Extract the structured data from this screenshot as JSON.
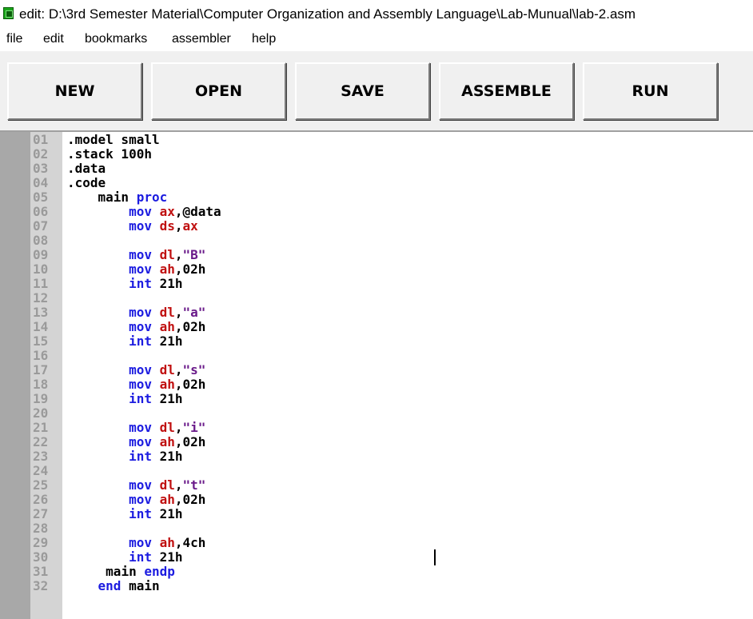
{
  "window": {
    "title": "edit: D:\\3rd Semester  Material\\Computer Organization and Assembly Language\\Lab-Munual\\lab-2.asm"
  },
  "menu": [
    "file",
    "edit",
    "bookmarks",
    "assembler",
    "help"
  ],
  "toolbar": {
    "new": "NEW",
    "open": "OPEN",
    "save": "SAVE",
    "assemble": "ASSEMBLE",
    "run": "RUN"
  },
  "editor": {
    "line_numbers": [
      "01",
      "02",
      "03",
      "04",
      "05",
      "06",
      "07",
      "08",
      "09",
      "10",
      "11",
      "12",
      "13",
      "14",
      "15",
      "16",
      "17",
      "18",
      "19",
      "20",
      "21",
      "22",
      "23",
      "24",
      "25",
      "26",
      "27",
      "28",
      "29",
      "30",
      "31",
      "32"
    ],
    "lines": [
      {
        "indent": "",
        "tokens": [
          {
            "t": ".model small",
            "c": "p"
          }
        ]
      },
      {
        "indent": "",
        "tokens": [
          {
            "t": ".stack 100h",
            "c": "p"
          }
        ]
      },
      {
        "indent": "",
        "tokens": [
          {
            "t": ".data",
            "c": "p"
          }
        ]
      },
      {
        "indent": "",
        "tokens": [
          {
            "t": ".code",
            "c": "p"
          }
        ]
      },
      {
        "indent": "    ",
        "tokens": [
          {
            "t": "main ",
            "c": "p"
          },
          {
            "t": "proc",
            "c": "k"
          }
        ]
      },
      {
        "indent": "        ",
        "tokens": [
          {
            "t": "mov ",
            "c": "k"
          },
          {
            "t": "ax",
            "c": "r"
          },
          {
            "t": ",@data",
            "c": "p"
          }
        ]
      },
      {
        "indent": "        ",
        "tokens": [
          {
            "t": "mov ",
            "c": "k"
          },
          {
            "t": "ds",
            "c": "r"
          },
          {
            "t": ",",
            "c": "p"
          },
          {
            "t": "ax",
            "c": "r"
          }
        ]
      },
      {
        "indent": "",
        "tokens": []
      },
      {
        "indent": "        ",
        "tokens": [
          {
            "t": "mov ",
            "c": "k"
          },
          {
            "t": "dl",
            "c": "r"
          },
          {
            "t": ",",
            "c": "p"
          },
          {
            "t": "\"B\"",
            "c": "s"
          }
        ]
      },
      {
        "indent": "        ",
        "tokens": [
          {
            "t": "mov ",
            "c": "k"
          },
          {
            "t": "ah",
            "c": "r"
          },
          {
            "t": ",02h",
            "c": "p"
          }
        ]
      },
      {
        "indent": "        ",
        "tokens": [
          {
            "t": "int ",
            "c": "k"
          },
          {
            "t": "21h",
            "c": "p"
          }
        ]
      },
      {
        "indent": "",
        "tokens": []
      },
      {
        "indent": "        ",
        "tokens": [
          {
            "t": "mov ",
            "c": "k"
          },
          {
            "t": "dl",
            "c": "r"
          },
          {
            "t": ",",
            "c": "p"
          },
          {
            "t": "\"a\"",
            "c": "s"
          }
        ]
      },
      {
        "indent": "        ",
        "tokens": [
          {
            "t": "mov ",
            "c": "k"
          },
          {
            "t": "ah",
            "c": "r"
          },
          {
            "t": ",02h",
            "c": "p"
          }
        ]
      },
      {
        "indent": "        ",
        "tokens": [
          {
            "t": "int ",
            "c": "k"
          },
          {
            "t": "21h",
            "c": "p"
          }
        ]
      },
      {
        "indent": "",
        "tokens": []
      },
      {
        "indent": "        ",
        "tokens": [
          {
            "t": "mov ",
            "c": "k"
          },
          {
            "t": "dl",
            "c": "r"
          },
          {
            "t": ",",
            "c": "p"
          },
          {
            "t": "\"s\"",
            "c": "s"
          }
        ]
      },
      {
        "indent": "        ",
        "tokens": [
          {
            "t": "mov ",
            "c": "k"
          },
          {
            "t": "ah",
            "c": "r"
          },
          {
            "t": ",02h",
            "c": "p"
          }
        ]
      },
      {
        "indent": "        ",
        "tokens": [
          {
            "t": "int ",
            "c": "k"
          },
          {
            "t": "21h",
            "c": "p"
          }
        ]
      },
      {
        "indent": "",
        "tokens": []
      },
      {
        "indent": "        ",
        "tokens": [
          {
            "t": "mov ",
            "c": "k"
          },
          {
            "t": "dl",
            "c": "r"
          },
          {
            "t": ",",
            "c": "p"
          },
          {
            "t": "\"i\"",
            "c": "s"
          }
        ]
      },
      {
        "indent": "        ",
        "tokens": [
          {
            "t": "mov ",
            "c": "k"
          },
          {
            "t": "ah",
            "c": "r"
          },
          {
            "t": ",02h",
            "c": "p"
          }
        ]
      },
      {
        "indent": "        ",
        "tokens": [
          {
            "t": "int ",
            "c": "k"
          },
          {
            "t": "21h",
            "c": "p"
          }
        ]
      },
      {
        "indent": "",
        "tokens": []
      },
      {
        "indent": "        ",
        "tokens": [
          {
            "t": "mov ",
            "c": "k"
          },
          {
            "t": "dl",
            "c": "r"
          },
          {
            "t": ",",
            "c": "p"
          },
          {
            "t": "\"t\"",
            "c": "s"
          }
        ]
      },
      {
        "indent": "        ",
        "tokens": [
          {
            "t": "mov ",
            "c": "k"
          },
          {
            "t": "ah",
            "c": "r"
          },
          {
            "t": ",02h",
            "c": "p"
          }
        ]
      },
      {
        "indent": "        ",
        "tokens": [
          {
            "t": "int ",
            "c": "k"
          },
          {
            "t": "21h",
            "c": "p"
          }
        ]
      },
      {
        "indent": "",
        "tokens": []
      },
      {
        "indent": "        ",
        "tokens": [
          {
            "t": "mov ",
            "c": "k"
          },
          {
            "t": "ah",
            "c": "r"
          },
          {
            "t": ",4ch",
            "c": "p"
          }
        ]
      },
      {
        "indent": "        ",
        "tokens": [
          {
            "t": "int ",
            "c": "k"
          },
          {
            "t": "21h",
            "c": "p"
          }
        ]
      },
      {
        "indent": "     ",
        "tokens": [
          {
            "t": "main ",
            "c": "p"
          },
          {
            "t": "endp",
            "c": "k"
          }
        ]
      },
      {
        "indent": "    ",
        "tokens": [
          {
            "t": "end ",
            "c": "k"
          },
          {
            "t": "main",
            "c": "p"
          }
        ]
      }
    ]
  },
  "colors": {
    "keyword": "#1c1ce0",
    "register": "#c01010",
    "string": "#6a1a8a",
    "plain": "#000000"
  }
}
